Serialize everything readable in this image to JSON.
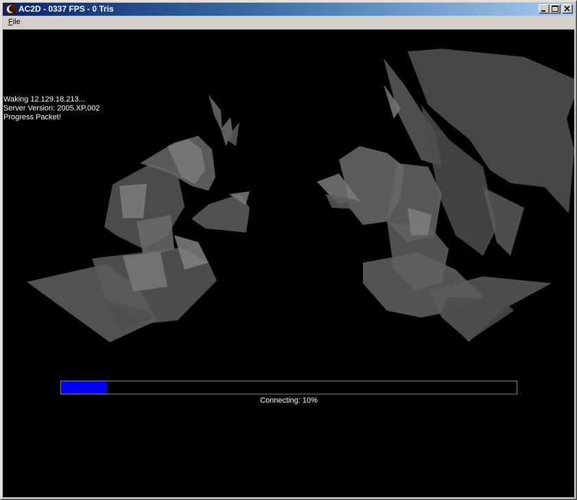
{
  "window": {
    "title": "AC2D - 0337 FPS - 0 Tris",
    "minimize_icon": "minimize-icon",
    "maximize_icon": "maximize-icon",
    "close_icon": "close-icon",
    "app_icon": "app-icon"
  },
  "menu": {
    "file_first": "F",
    "file_rest": "ile"
  },
  "log": {
    "lines": [
      "Waking 12.129.18.213...",
      "Server Version: 2005.XP.002",
      "Progress Packet!"
    ]
  },
  "progress": {
    "value": 0.1,
    "label": "Connecting: 10%",
    "fill_color": "#0000ff"
  }
}
